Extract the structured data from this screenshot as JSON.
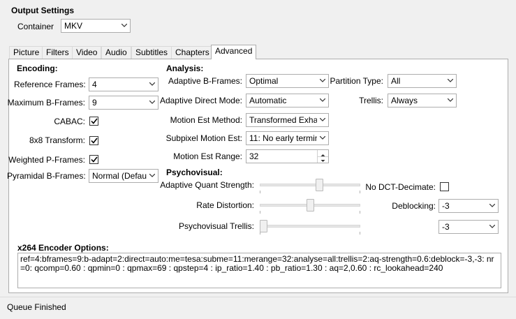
{
  "output": {
    "title": "Output Settings",
    "container_label": "Container",
    "container_value": "MKV"
  },
  "tabs": [
    {
      "label": "Picture"
    },
    {
      "label": "Filters"
    },
    {
      "label": "Video"
    },
    {
      "label": "Audio"
    },
    {
      "label": "Subtitles"
    },
    {
      "label": "Chapters"
    },
    {
      "label": "Advanced"
    }
  ],
  "active_tab": "Advanced",
  "encoding": {
    "heading": "Encoding:",
    "reference_frames_label": "Reference Frames:",
    "reference_frames_value": "4",
    "max_bframes_label": "Maximum B-Frames:",
    "max_bframes_value": "9",
    "cabac_label": "CABAC:",
    "cabac_checked": true,
    "transform8x8_label": "8x8 Transform:",
    "transform8x8_checked": true,
    "weighted_p_label": "Weighted P-Frames:",
    "weighted_p_checked": true,
    "pyramidal_label": "Pyramidal B-Frames:",
    "pyramidal_value": "Normal (Defau"
  },
  "analysis": {
    "heading": "Analysis:",
    "adaptive_bframes_label": "Adaptive B-Frames:",
    "adaptive_bframes_value": "Optimal",
    "adaptive_direct_label": "Adaptive Direct Mode:",
    "adaptive_direct_value": "Automatic",
    "motion_method_label": "Motion Est Method:",
    "motion_method_value": "Transformed Exhau",
    "subpixel_label": "Subpixel Motion Est:",
    "subpixel_value": "11: No early termin",
    "motion_range_label": "Motion Est Range:",
    "motion_range_value": "32",
    "partition_label": "Partition Type:",
    "partition_value": "All",
    "trellis_label": "Trellis:",
    "trellis_value": "Always"
  },
  "psychovisual": {
    "heading": "Psychovisual:",
    "aq_label": "Adaptive Quant Strength:",
    "aq_value": 0.6,
    "rd_label": "Rate Distortion:",
    "rd_value": 0.5,
    "trellis_label": "Psychovisual Trellis:",
    "trellis_value": 0,
    "no_dct_label": "No DCT-Decimate:",
    "no_dct_checked": false,
    "deblocking_label": "Deblocking:",
    "deblocking_value1": "-3",
    "deblocking_value2": "-3"
  },
  "x264": {
    "label": "x264 Encoder Options:",
    "options": "ref=4:bframes=9:b-adapt=2:direct=auto:me=tesa:subme=11:merange=32:analyse=all:trellis=2:aq-strength=0.6:deblock=-3,-3: nr=0: qcomp=0.60 : qpmin=0 : qpmax=69 : qpstep=4 : ip_ratio=1.40 : pb_ratio=1.30 : aq=2,0.60 : rc_lookahead=240"
  },
  "status": {
    "text": "Queue Finished"
  }
}
